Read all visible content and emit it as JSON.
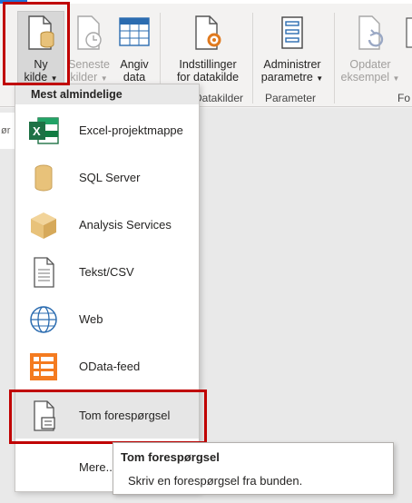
{
  "ribbon": {
    "groups": [
      {
        "label": ""
      },
      {
        "label": "Datakilder"
      },
      {
        "label": "Parameter"
      },
      {
        "label": "Fo"
      }
    ],
    "buttons": [
      {
        "label_line1": "Ny",
        "label_line2": "kilde",
        "has_dropdown": true,
        "icon": "database-document-icon"
      },
      {
        "label_line1": "Seneste",
        "label_line2": "kilder",
        "has_dropdown": true,
        "disabled": true,
        "icon": "recent-sources-icon"
      },
      {
        "label_line1": "Angiv",
        "label_line2": "data",
        "icon": "table-icon"
      },
      {
        "label_line1": "Indstillinger",
        "label_line2": "for datakilde",
        "icon": "gear-document-icon"
      },
      {
        "label_line1": "Administrer",
        "label_line2": "parametre",
        "has_dropdown": true,
        "icon": "parameters-icon"
      },
      {
        "label_line1": "Opdater",
        "label_line2": "eksempel",
        "has_dropdown": true,
        "disabled": true,
        "icon": "refresh-icon"
      },
      {
        "label_line1": "",
        "label_line2": "",
        "icon": "partial-icon"
      }
    ]
  },
  "left_edge_text": "ør",
  "dropdown": {
    "header": "Mest almindelige",
    "items": [
      {
        "label": "Excel-projektmappe",
        "icon": "excel-icon"
      },
      {
        "label": "SQL Server",
        "icon": "database-icon"
      },
      {
        "label": "Analysis Services",
        "icon": "cube-icon"
      },
      {
        "label": "Tekst/CSV",
        "icon": "text-file-icon"
      },
      {
        "label": "Web",
        "icon": "globe-icon"
      },
      {
        "label": "OData-feed",
        "icon": "odata-icon"
      },
      {
        "label": "Tom forespørgsel",
        "icon": "blank-query-icon",
        "highlighted": true
      }
    ],
    "more": "Mere..."
  },
  "tooltip": {
    "title": "Tom forespørgsel",
    "description": "Skriv en forespørgsel fra bunden."
  },
  "colors": {
    "highlight_box": "#c00000",
    "excel_green": "#1e7145",
    "database_tan": "#e8c27a",
    "odata_orange": "#f47b20",
    "accent_blue": "#1f6fd6"
  }
}
